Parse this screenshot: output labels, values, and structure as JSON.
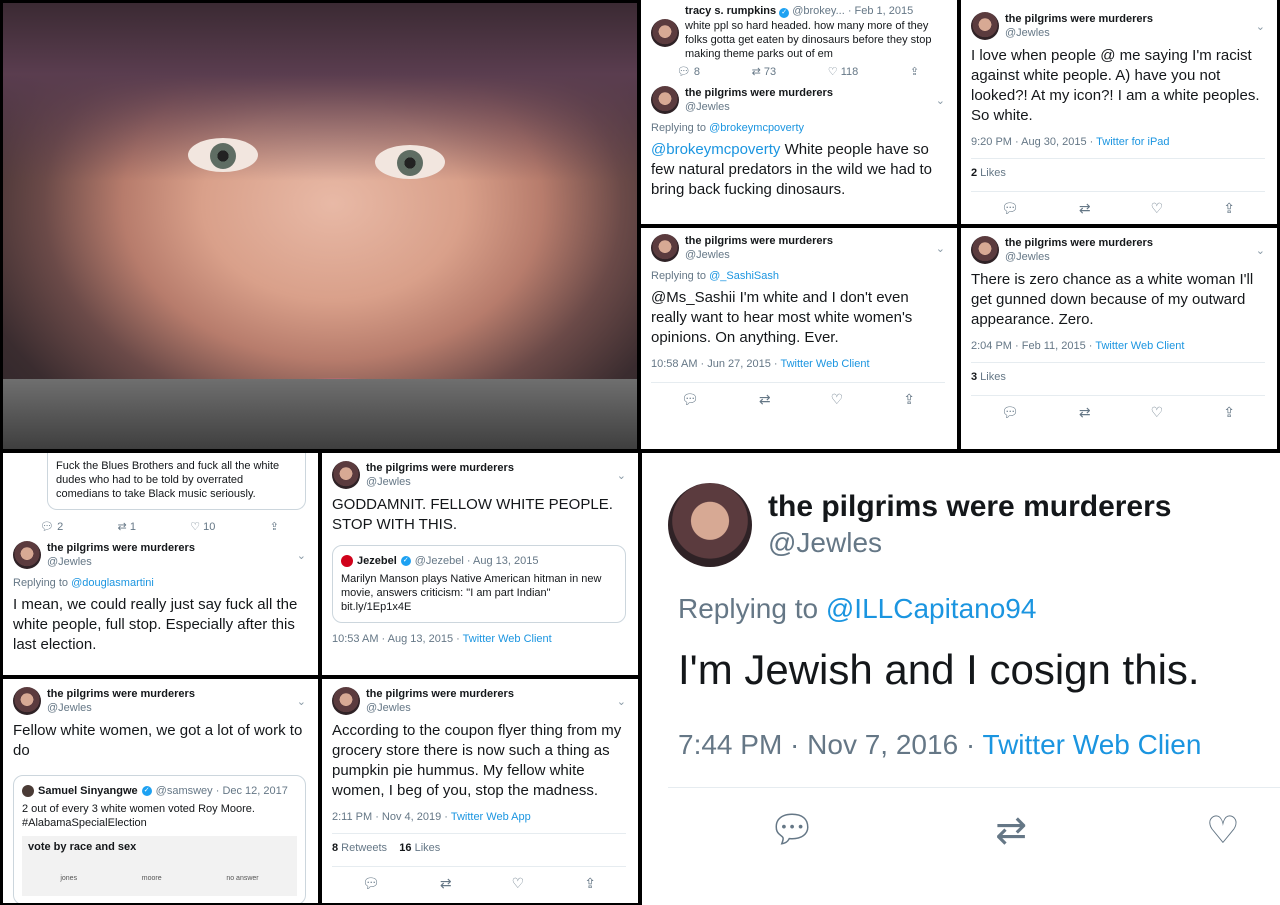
{
  "pilgrims": {
    "name": "the pilgrims were murderers",
    "handle": "@Jewles"
  },
  "t1": {
    "name": "tracy s. rumpkins",
    "handle": "@brokey...",
    "date": "· Feb 1, 2015",
    "text": "white ppl so hard headed. how many more of they folks gotta get eaten by dinosaurs before they stop making theme parks out of em",
    "replies": "8",
    "retweets": "73",
    "likes": "118"
  },
  "t2": {
    "reply_prefix": "Replying to ",
    "reply_to": "@brokeymcpoverty",
    "mention": "@brokeymcpoverty",
    "text": " White people have so few natural predators in the wild we had to bring back fucking dinosaurs."
  },
  "t3": {
    "text": "I love when people @ me saying I'm racist against white people. A) have you not looked?! At my icon?! I am a white peoples. So white.",
    "time": "9:20 PM · Aug 30, 2015 · ",
    "client": "Twitter for iPad",
    "likes_count": "2",
    "likes_label": " Likes"
  },
  "t4": {
    "reply_prefix": "Replying to ",
    "reply_to": "@_SashiSash",
    "text": "@Ms_Sashii I'm white and I don't even really want to hear most white women's opinions. On anything. Ever.",
    "time": "10:58 AM · Jun 27, 2015 · ",
    "client": "Twitter Web Client"
  },
  "t5": {
    "text": "There is zero chance as a white woman I'll get gunned down because of my outward appearance. Zero.",
    "time": "2:04 PM · Feb 11, 2015 · ",
    "client": "Twitter Web Client",
    "likes_count": "3",
    "likes_label": " Likes"
  },
  "t6": {
    "quoted_text": "Fuck the Blues Brothers and fuck all the white dudes who had to be told by overrated comedians to take Black music seriously.",
    "replies": "2",
    "retweets": "1",
    "likes": "10",
    "reply_prefix": "Replying to ",
    "reply_to": "@douglasmartini",
    "text": "I mean, we could really just say fuck all the white people, full stop. Especially after this last election."
  },
  "t7": {
    "text": "GODDAMNIT. FELLOW WHITE PEOPLE. STOP WITH THIS.",
    "q_name": "Jezebel",
    "q_handle": "@Jezebel · Aug 13, 2015",
    "q_text": "Marilyn Manson plays Native American hitman in new movie, answers criticism: \"I am part Indian\" bit.ly/1Ep1x4E",
    "time": "10:53 AM · Aug 13, 2015 · ",
    "client": "Twitter Web Client"
  },
  "t8": {
    "text": "Fellow white women, we got a lot of work to do",
    "q_name": "Samuel Sinyangwe",
    "q_handle": "@samswey · Dec 12, 2017",
    "q_text": "2 out of every 3 white women voted Roy Moore. #AlabamaSpecialElection",
    "q_chart_title": "vote by race and sex",
    "q_cols": [
      "jones",
      "moore",
      "no answer"
    ]
  },
  "t9": {
    "text": "According to the coupon flyer thing from my grocery store there is now such a thing as pumpkin pie hummus. My fellow white women, I beg of you, stop the madness.",
    "time": "2:11 PM · Nov 4, 2019 · ",
    "client": "Twitter Web App",
    "retweets_count": "8",
    "retweets_label": " Retweets",
    "likes_count": "16",
    "likes_label": " Likes"
  },
  "t10": {
    "reply_prefix": "Replying to ",
    "reply_to": "@ILLCapitano94",
    "text": "I'm Jewish and I cosign this.",
    "time": "7:44 PM · Nov 7, 2016 · ",
    "client": "Twitter Web Clien"
  },
  "icons": {
    "reply": "reply-icon",
    "retweet": "retweet-icon",
    "like": "like-icon",
    "share": "share-icon",
    "chevron": "chevron-down-icon",
    "verified": "verified-icon"
  },
  "colors": {
    "link": "#1b95e0",
    "muted": "#657786",
    "text": "#14171a",
    "verified": "#1da1f2"
  }
}
